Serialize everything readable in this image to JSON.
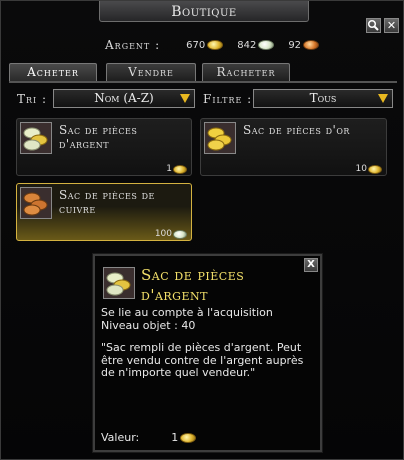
{
  "window": {
    "title": "Boutique"
  },
  "icons": {
    "search": "magnifier-icon",
    "close": "close-icon"
  },
  "currency": {
    "label": "Argent :",
    "gold": "670",
    "silver": "842",
    "copper": "92"
  },
  "tabs": [
    {
      "label": "Acheter",
      "active": true
    },
    {
      "label": "Vendre",
      "active": false
    },
    {
      "label": "Racheter",
      "active": false
    }
  ],
  "filters": {
    "sort_label": "Tri :",
    "sort_value": "Nom (A-Z)",
    "filter_label": "Filtre :",
    "filter_value": "Tous"
  },
  "items": [
    {
      "name_line1": "Sac de pièces",
      "name_line2": "d'argent",
      "qty": "1",
      "coin": "gold"
    },
    {
      "name_line1": "Sac de pièces d'or",
      "name_line2": "",
      "qty": "10",
      "coin": "gold"
    },
    {
      "name_line1": "Sac de pièces de",
      "name_line2": "cuivre",
      "qty": "100",
      "coin": "silver",
      "selected": true
    }
  ],
  "tooltip": {
    "title": "Sac de pièces d'argent",
    "bind": "Se lie au compte à l'acquisition",
    "level": "Niveau objet : 40",
    "description": "\"Sac rempli de pièces d'argent. Peut être vendu contre de l'argent auprès de n'importe quel vendeur.\"",
    "value_label": "Valeur:",
    "value": "1"
  },
  "colors": {
    "title_gold": "#f3e06a",
    "selected_border": "#d4b240",
    "arrow": "#e8b820"
  }
}
